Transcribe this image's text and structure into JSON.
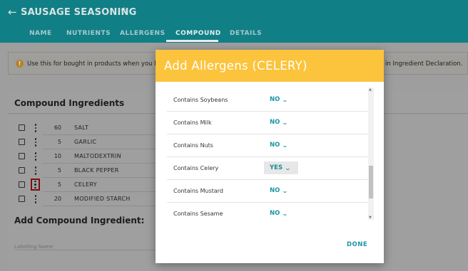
{
  "header": {
    "title": "SAUSAGE SEASONING",
    "tabs": [
      "NAME",
      "NUTRIENTS",
      "ALLERGENS",
      "COMPOUND",
      "DETAILS"
    ],
    "active_tab": "COMPOUND"
  },
  "banner": {
    "text_left": "Use this for bought in products when you ha",
    "text_right": "in Ingredient Declaration."
  },
  "compound": {
    "title": "Compound Ingredients",
    "ingredients": [
      {
        "qty": "60",
        "name": "SALT"
      },
      {
        "qty": "5",
        "name": "GARLIC"
      },
      {
        "qty": "10",
        "name": "MALTODEXTRIN"
      },
      {
        "qty": "5",
        "name": "BLACK PEPPER"
      },
      {
        "qty": "5",
        "name": "CELERY"
      },
      {
        "qty": "20",
        "name": "MODIFIED STARCH"
      }
    ],
    "add_title": "Add Compound Ingredient:",
    "labelling_placeholder": "Labelling Name"
  },
  "modal": {
    "title": "Add Allergens (CELERY)",
    "rows": [
      {
        "label": "Contains Soybeans",
        "value": "NO"
      },
      {
        "label": "Contains Milk",
        "value": "NO"
      },
      {
        "label": "Contains Nuts",
        "value": "NO"
      },
      {
        "label": "Contains Celery",
        "value": "YES"
      },
      {
        "label": "Contains Mustard",
        "value": "NO"
      },
      {
        "label": "Contains Sesame",
        "value": "NO"
      }
    ],
    "done_label": "DONE"
  },
  "colors": {
    "header_teal": "#00bfc9",
    "modal_header": "#fcc43c",
    "accent_teal": "#1a97a4",
    "selected_outline": "#7f0d10"
  }
}
